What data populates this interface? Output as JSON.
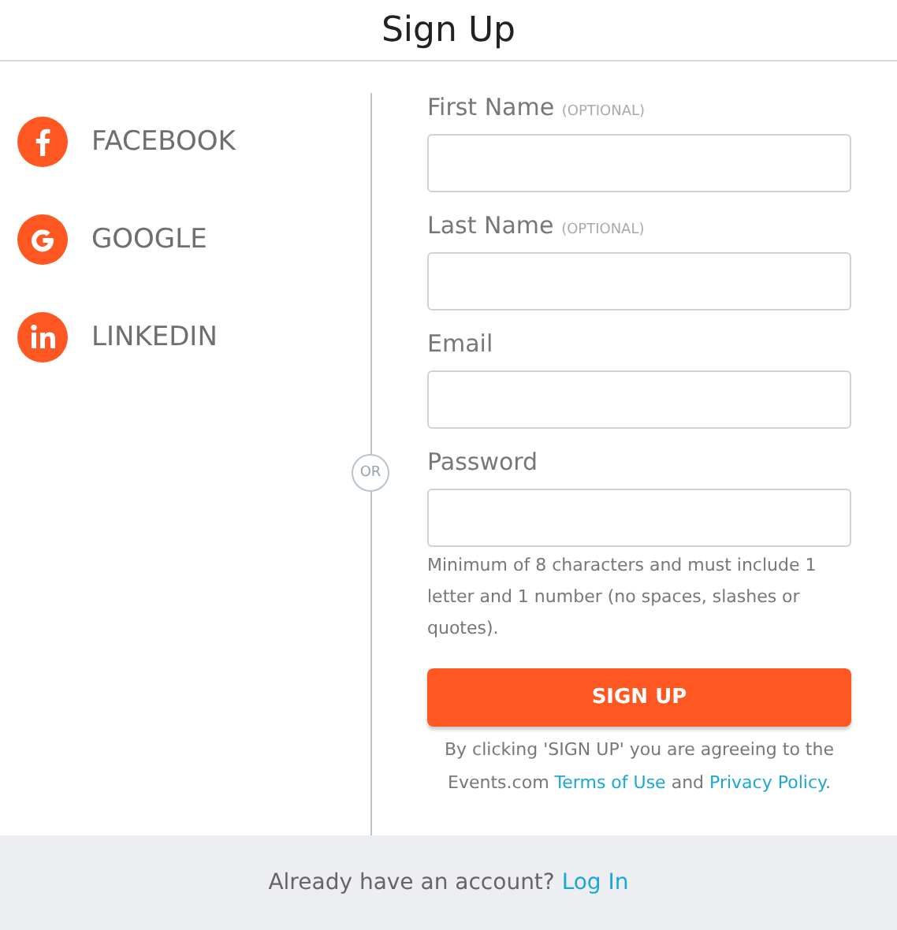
{
  "title": "Sign Up",
  "social": [
    {
      "kind": "facebook",
      "label": "FACEBOOK"
    },
    {
      "kind": "google",
      "label": "GOOGLE"
    },
    {
      "kind": "linkedin",
      "label": "LINKEDIN"
    }
  ],
  "divider": "OR",
  "fields": [
    {
      "label": "First Name",
      "note": "(OPTIONAL)"
    },
    {
      "label": "Last Name",
      "note": "(OPTIONAL)"
    },
    {
      "label": "Email"
    },
    {
      "label": "Password",
      "hint": "Minimum of 8 characters and must include 1 letter and 1 number (no spaces, slashes or quotes)."
    }
  ],
  "submit": "SIGN UP",
  "agreement": {
    "before": "By clicking 'SIGN UP' you are agreeing to the Events.com ",
    "terms": "Terms of Use",
    "middle": " and ",
    "privacy": "Privacy Policy",
    "after": "."
  },
  "footer": {
    "text": "Already have an account? ",
    "link": "Log In"
  }
}
